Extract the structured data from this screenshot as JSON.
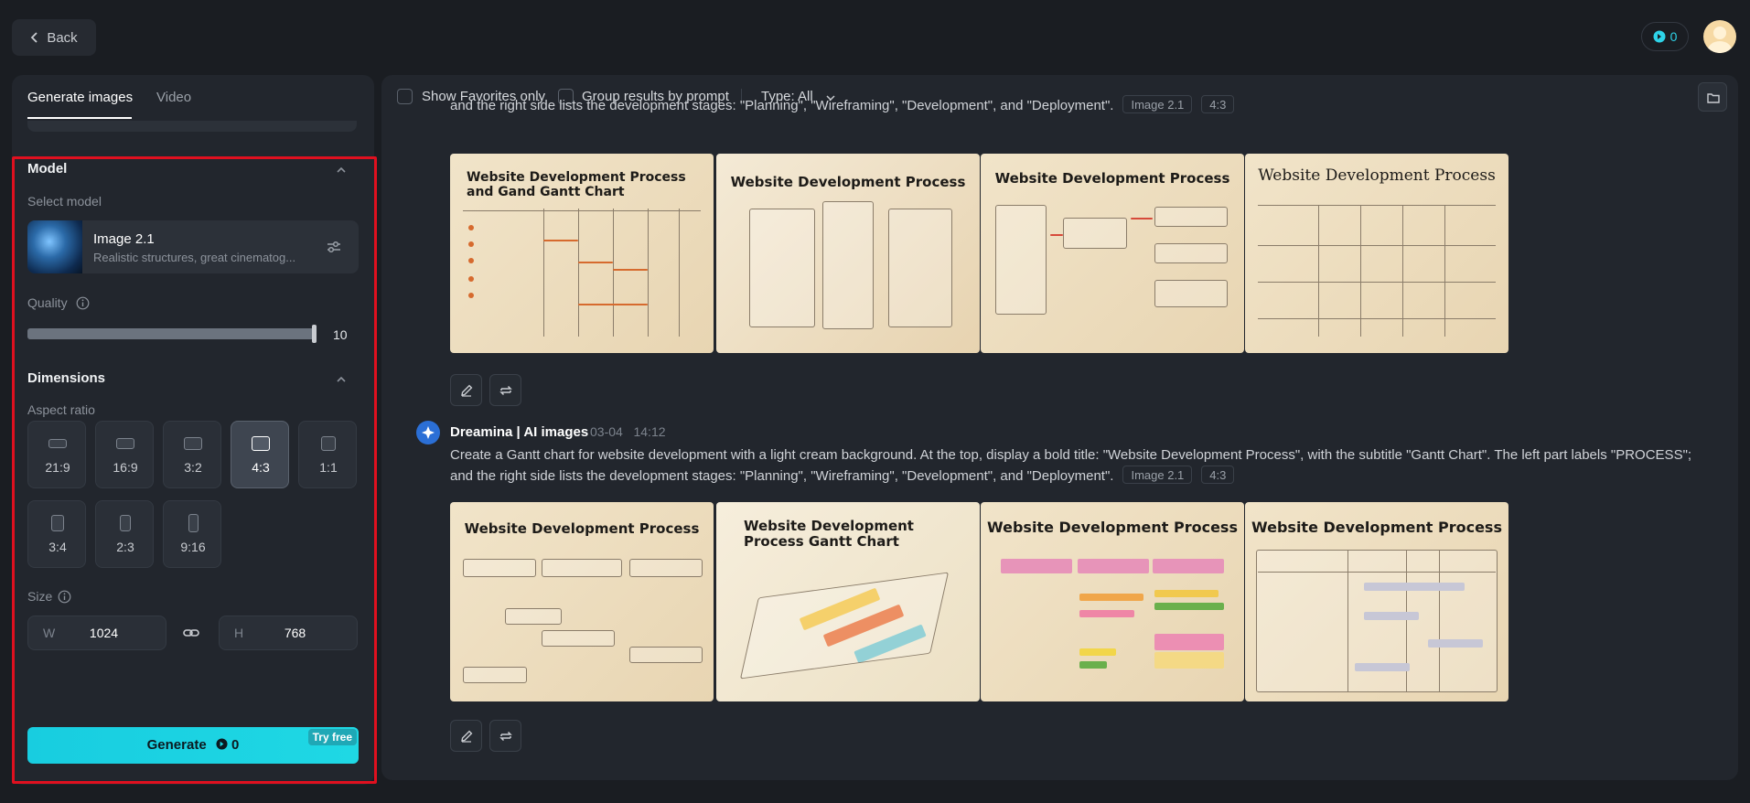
{
  "topbar": {
    "back_label": "Back",
    "credits": "0"
  },
  "left_panel": {
    "tabs": [
      {
        "label": "Generate images",
        "active": true
      },
      {
        "label": "Video",
        "active": false
      }
    ],
    "model_section": {
      "title": "Model",
      "select_label": "Select model",
      "model_name": "Image 2.1",
      "model_desc": "Realistic structures, great cinematog..."
    },
    "quality": {
      "label": "Quality",
      "value": "10",
      "fill_fraction": 1.0
    },
    "dimensions": {
      "title": "Dimensions",
      "aspect_label": "Aspect ratio",
      "ratios": [
        "21:9",
        "16:9",
        "3:2",
        "4:3",
        "1:1",
        "3:4",
        "2:3",
        "9:16"
      ],
      "selected_ratio": "4:3",
      "size_label": "Size",
      "width_prefix": "W",
      "width": "1024",
      "height_prefix": "H",
      "height": "768"
    },
    "generate": {
      "label": "Generate",
      "cost": "0",
      "badge": "Try free"
    }
  },
  "right_panel": {
    "filters": {
      "show_favorites": "Show Favorites only",
      "group_results": "Group results by prompt",
      "type_filter": "Type: All"
    },
    "generations": [
      {
        "author": "",
        "date": "",
        "time": "",
        "prompt": "and the right side lists the development stages: \"Planning\", \"Wireframing\", \"Development\", and \"Deployment\".",
        "model_tag": "Image 2.1",
        "ratio_tag": "4:3",
        "images": [
          {
            "title": "Website Development Process and Gand Gantt Chart"
          },
          {
            "title": "Website Development Process"
          },
          {
            "title": "Website Development Process"
          },
          {
            "title": "Website Development Process"
          }
        ]
      },
      {
        "author": "Dreamina | AI images",
        "date": "03-04",
        "time": "14:12",
        "prompt_line1": "Create a Gantt chart for website development with a light cream background. At the top, display a bold title: \"Website Development Process\", with the subtitle \"Gantt Chart\". The left part labels \"PROCESS\";",
        "prompt_line2": "and the right side lists the development stages: \"Planning\", \"Wireframing\", \"Development\", and \"Deployment\".",
        "model_tag": "Image 2.1",
        "ratio_tag": "4:3",
        "images": [
          {
            "title": "Website Development Process"
          },
          {
            "title": "Website Development Process Gantt Chart"
          },
          {
            "title": "Website Development Process"
          },
          {
            "title": "Website Development Process"
          }
        ]
      }
    ]
  },
  "colors": {
    "accent": "#1fd8e4",
    "highlight_frame": "#e0101f",
    "background": "#1a1d22",
    "panel": "#22262d"
  }
}
